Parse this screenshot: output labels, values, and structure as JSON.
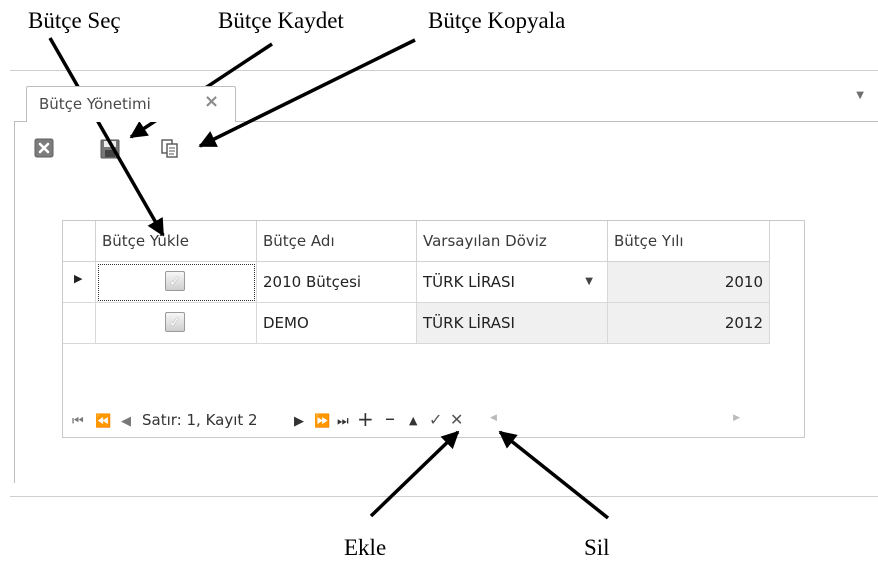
{
  "annotations": {
    "butce_sec": "Bütçe Seç",
    "butce_kaydet": "Bütçe Kaydet",
    "butce_kopyala": "Bütçe Kopyala",
    "ekle": "Ekle",
    "sil": "Sil"
  },
  "tab": {
    "label": "Bütçe Yönetimi",
    "close_icon": "×"
  },
  "toolbar": {
    "icons": [
      "close-icon",
      "save-icon",
      "copy-icon"
    ]
  },
  "grid": {
    "columns": [
      "Bütçe Yükle",
      "Bütçe Adı",
      "Varsayılan Döviz",
      "Bütçe Yılı"
    ],
    "rows": [
      {
        "loaded": true,
        "name": "2010 Bütçesi",
        "currency": "TÜRK LİRASI",
        "year": "2010"
      },
      {
        "loaded": true,
        "name": "DEMO",
        "currency": "TÜRK LİRASI",
        "year": "2012"
      }
    ]
  },
  "navigator": {
    "status": "Satır: 1, Kayıt 2"
  }
}
